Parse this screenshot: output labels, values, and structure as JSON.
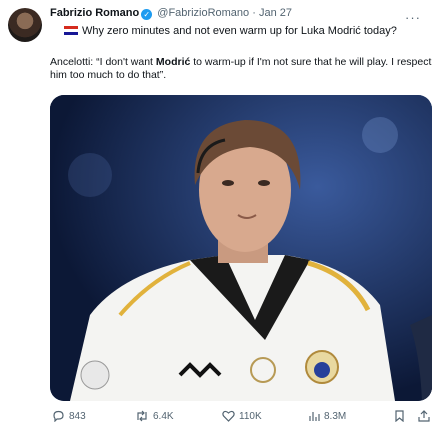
{
  "author": {
    "name": "Fabrizio Romano",
    "handle": "@FabrizioRomano",
    "separator": "·",
    "date": "Jan 27"
  },
  "quoted_line": "Why zero minutes and not even warm up for Luka Modrić today?",
  "body_prefix": "Ancelotti: “I don't want ",
  "body_bold": "Modrić",
  "body_suffix": " to warm-up if I'm not sure that he will play. I respect him too much to do that”.",
  "actions": {
    "replies": "843",
    "reposts": "6.4K",
    "likes": "110K",
    "views": "8.3M"
  }
}
